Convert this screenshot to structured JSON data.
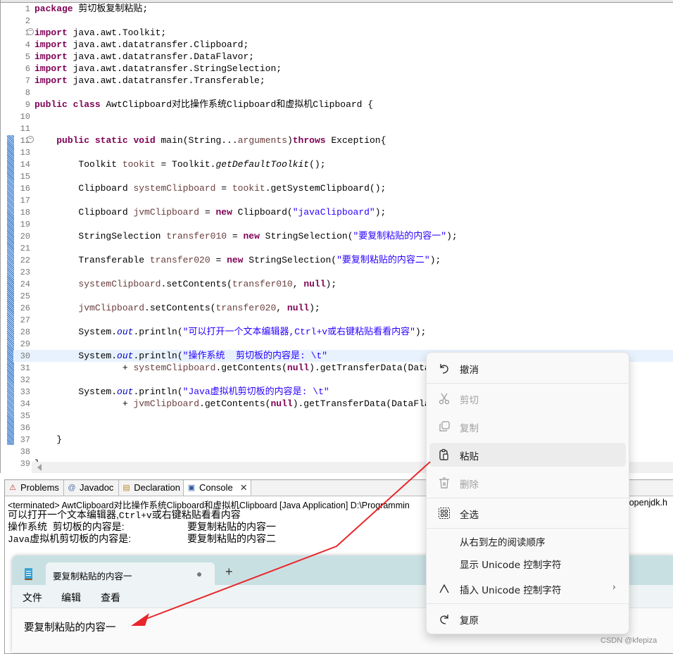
{
  "editor": {
    "lines": [
      {
        "n": "1",
        "html": "<span class='kw'>package</span> 剪切板复制粘贴;"
      },
      {
        "n": "2",
        "html": ""
      },
      {
        "n": "3",
        "fold": true,
        "html": "<span class='kw'>import</span> java.awt.Toolkit;"
      },
      {
        "n": "4",
        "html": "<span class='kw'>import</span> java.awt.datatransfer.Clipboard;"
      },
      {
        "n": "5",
        "html": "<span class='kw'>import</span> java.awt.datatransfer.DataFlavor;"
      },
      {
        "n": "6",
        "html": "<span class='kw'>import</span> java.awt.datatransfer.StringSelection;"
      },
      {
        "n": "7",
        "html": "<span class='kw'>import</span> java.awt.datatransfer.Transferable;"
      },
      {
        "n": "8",
        "html": ""
      },
      {
        "n": "9",
        "html": "<span class='kw'>public</span> <span class='kw'>class</span> AwtClipboard对比操作系统Clipboard和虚拟机Clipboard {"
      },
      {
        "n": "10",
        "html": ""
      },
      {
        "n": "11",
        "html": ""
      },
      {
        "n": "12",
        "fold": true,
        "html": "    <span class='kw'>public</span> <span class='kw'>static</span> <span class='kw'>void</span> main(String...<span class='var'>arguments</span>)<span class='kw'>throws</span> Exception{"
      },
      {
        "n": "13",
        "html": ""
      },
      {
        "n": "14",
        "html": "        Toolkit <span class='var'>tookit</span> = Toolkit.<span class='it'>getDefaultToolkit</span>();"
      },
      {
        "n": "15",
        "html": ""
      },
      {
        "n": "16",
        "html": "        Clipboard <span class='var'>systemClipboard</span> = <span class='var'>tookit</span>.getSystemClipboard();"
      },
      {
        "n": "17",
        "html": ""
      },
      {
        "n": "18",
        "html": "        Clipboard <span class='var'>jvmClipboard</span> = <span class='kw'>new</span> Clipboard(<span class='str'>\"javaClipboard\"</span>);"
      },
      {
        "n": "19",
        "html": ""
      },
      {
        "n": "20",
        "html": "        StringSelection <span class='var'>transfer010</span> = <span class='kw'>new</span> StringSelection(<span class='str'>\"要复制粘贴的内容一\"</span>);"
      },
      {
        "n": "21",
        "html": ""
      },
      {
        "n": "22",
        "html": "        Transferable <span class='var'>transfer020</span> = <span class='kw'>new</span> StringSelection(<span class='str'>\"要复制粘贴的内容二\"</span>);"
      },
      {
        "n": "23",
        "html": ""
      },
      {
        "n": "24",
        "html": "        <span class='var'>systemClipboard</span>.setContents(<span class='var'>transfer010</span>, <span class='kw'>null</span>);"
      },
      {
        "n": "25",
        "html": ""
      },
      {
        "n": "26",
        "html": "        <span class='var'>jvmClipboard</span>.setContents(<span class='var'>transfer020</span>, <span class='kw'>null</span>);"
      },
      {
        "n": "27",
        "html": ""
      },
      {
        "n": "28",
        "html": "        System.<span class='fld'>out</span>.println(<span class='str'>\"可以打开一个文本编辑器,Ctrl+v或右键粘贴看看内容\"</span>);"
      },
      {
        "n": "29",
        "html": ""
      },
      {
        "n": "30",
        "current": true,
        "html": "        System.<span class='fld'>out</span>.println(<span class='str'>\"操作系统  剪切板的内容是: \\t\"</span>"
      },
      {
        "n": "31",
        "html": "                + <span class='var'>systemClipboard</span>.getContents(<span class='kw'>null</span>).getTransferData(DataFlavor.<span class='fld'>stringFlavor</span>));"
      },
      {
        "n": "32",
        "html": ""
      },
      {
        "n": "33",
        "html": "        System.<span class='fld'>out</span>.println(<span class='str'>\"Java虚拟机剪切板的内容是: \\t\"</span>"
      },
      {
        "n": "34",
        "html": "                + <span class='var'>jvmClipboard</span>.getContents(<span class='kw'>null</span>).getTransferData(DataFlavor.<span class='fld'>stringFlavor</span>));"
      },
      {
        "n": "35",
        "html": ""
      },
      {
        "n": "36",
        "html": ""
      },
      {
        "n": "37",
        "html": "    }"
      },
      {
        "n": "38",
        "html": ""
      },
      {
        "n": "39",
        "html": "}"
      }
    ]
  },
  "panel": {
    "tabs": [
      {
        "label": "Problems",
        "icon": "problems-icon"
      },
      {
        "label": "Javadoc",
        "icon": "javadoc-icon"
      },
      {
        "label": "Declaration",
        "icon": "declaration-icon"
      },
      {
        "label": "Console",
        "icon": "console-icon",
        "active": true
      }
    ],
    "console_status": "<terminated> AwtClipboard对比操作系统Clipboard和虚拟机Clipboard [Java Application] D:\\Programmin",
    "console_status_tail": "tj.openjdk.h",
    "output": [
      {
        "prefix": "可以打开一个文本编辑器,",
        "mono": "Ctrl+v",
        "suffix": "或右键粘贴看看内容",
        "value": ""
      },
      {
        "prefix": "操作系统  剪切板的内容是:",
        "mono": "",
        "suffix": "",
        "value": "要复制粘贴的内容一"
      },
      {
        "prefix": "",
        "mono": "Java",
        "suffix": "虚拟机剪切板的内容是:",
        "value": "要复制粘贴的内容二"
      }
    ]
  },
  "notepad": {
    "tab_title": "要复制粘贴的内容一",
    "new_tab": "+",
    "menus": [
      "文件",
      "编辑",
      "查看"
    ],
    "content": "要复制粘贴的内容一"
  },
  "context_menu": {
    "items": [
      {
        "label": "撤消",
        "icon": "undo-icon",
        "state": "normal"
      },
      {
        "label": "剪切",
        "icon": "cut-icon",
        "state": "disabled"
      },
      {
        "label": "复制",
        "icon": "copy-icon",
        "state": "disabled"
      },
      {
        "label": "粘贴",
        "icon": "paste-icon",
        "state": "hover"
      },
      {
        "label": "删除",
        "icon": "delete-icon",
        "state": "disabled"
      },
      {
        "label": "全选",
        "icon": "select-all-icon",
        "state": "normal"
      },
      {
        "label": "从右到左的阅读顺序",
        "icon": "",
        "state": "normal"
      },
      {
        "label": "显示 Unicode 控制字符",
        "icon": "",
        "state": "normal"
      },
      {
        "label": "插入 Unicode 控制字符",
        "icon": "insert-unicode-icon",
        "state": "normal",
        "submenu": "›"
      },
      {
        "label": "复原",
        "icon": "redo-icon",
        "state": "normal"
      }
    ]
  },
  "watermark": "CSDN @kfepiza",
  "colors": {
    "annotation_arrow": "#e8262b",
    "keyword": "#7f0055",
    "string": "#2a00ff"
  }
}
